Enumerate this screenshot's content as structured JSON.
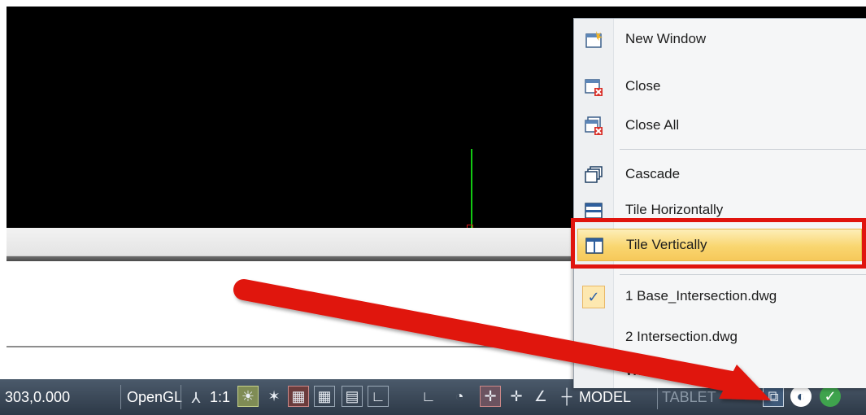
{
  "status_bar": {
    "coords": "303,0.000",
    "renderer": "OpenGL",
    "scale": "1:1",
    "model": "MODEL",
    "tablet": "TABLET"
  },
  "menu": {
    "items": [
      {
        "label": "New Window",
        "icon": "new-window-icon"
      },
      {
        "label": "Close",
        "icon": "close-window-icon"
      },
      {
        "label": "Close All",
        "icon": "close-all-icon"
      },
      {
        "label": "Cascade",
        "icon": "cascade-icon"
      },
      {
        "label": "Tile Horizontally",
        "icon": "tile-horizontally-icon"
      },
      {
        "label": "Tile Vertically",
        "icon": "tile-vertically-icon"
      },
      {
        "label": "1 Base_Intersection.dwg",
        "icon": "checkmark-icon"
      },
      {
        "label": "2 Intersection.dwg",
        "icon": ""
      },
      {
        "label": "Windows...",
        "icon": ""
      }
    ],
    "highlighted": "Tile Vertically"
  },
  "colors": {
    "annotation": "#e0140e",
    "ucs_x": "#d21818",
    "ucs_y": "#12c812",
    "highlight": "#f9d670"
  }
}
